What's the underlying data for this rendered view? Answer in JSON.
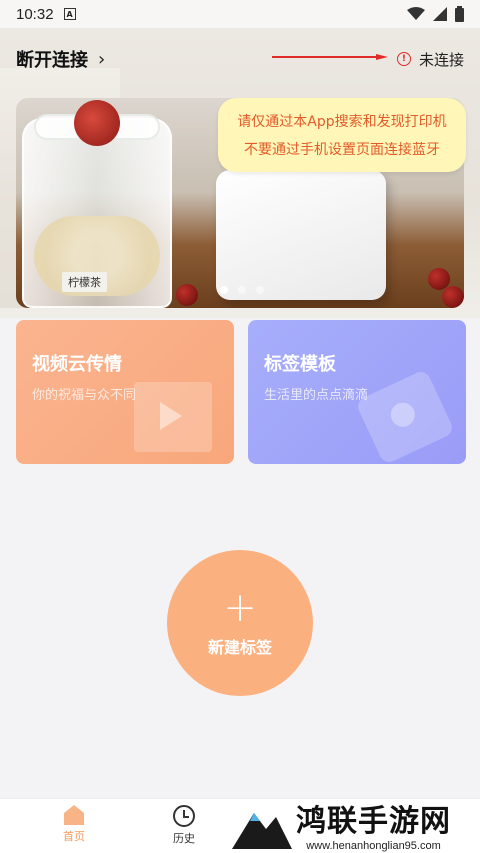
{
  "status_bar": {
    "time": "10:32",
    "notification_badge": "A",
    "icons": [
      "wifi-icon",
      "signal-icon",
      "battery-icon"
    ]
  },
  "header": {
    "title": "断开连接",
    "connection_status": "未连接",
    "warning_icon": "alert-circle-icon"
  },
  "tooltip": {
    "line1": "请仅通过本App搜索和发现打印机",
    "line2": "不要通过手机设置页面连接蓝牙"
  },
  "banner": {
    "jar_label": "柠檬茶",
    "slide_count": 3,
    "active_slide": 1
  },
  "cards": {
    "video": {
      "title": "视频云传情",
      "subtitle": "你的祝福与众不同"
    },
    "label": {
      "title": "标签模板",
      "subtitle": "生活里的点点滴滴"
    }
  },
  "fab": {
    "label": "新建标签"
  },
  "bottom_nav": {
    "items": [
      {
        "label": "首页",
        "icon": "home-icon",
        "active": true
      },
      {
        "label": "历史",
        "icon": "clock-icon",
        "active": false
      }
    ]
  },
  "watermark": {
    "title": "鸿联手游网",
    "url": "www.henanhonglian95.com"
  },
  "colors": {
    "accent": "#f8a77b",
    "label_card": "#9a9cf7",
    "warning": "#e02b2b",
    "tooltip_bg": "#fff6b8",
    "tooltip_text": "#e35b2a"
  }
}
